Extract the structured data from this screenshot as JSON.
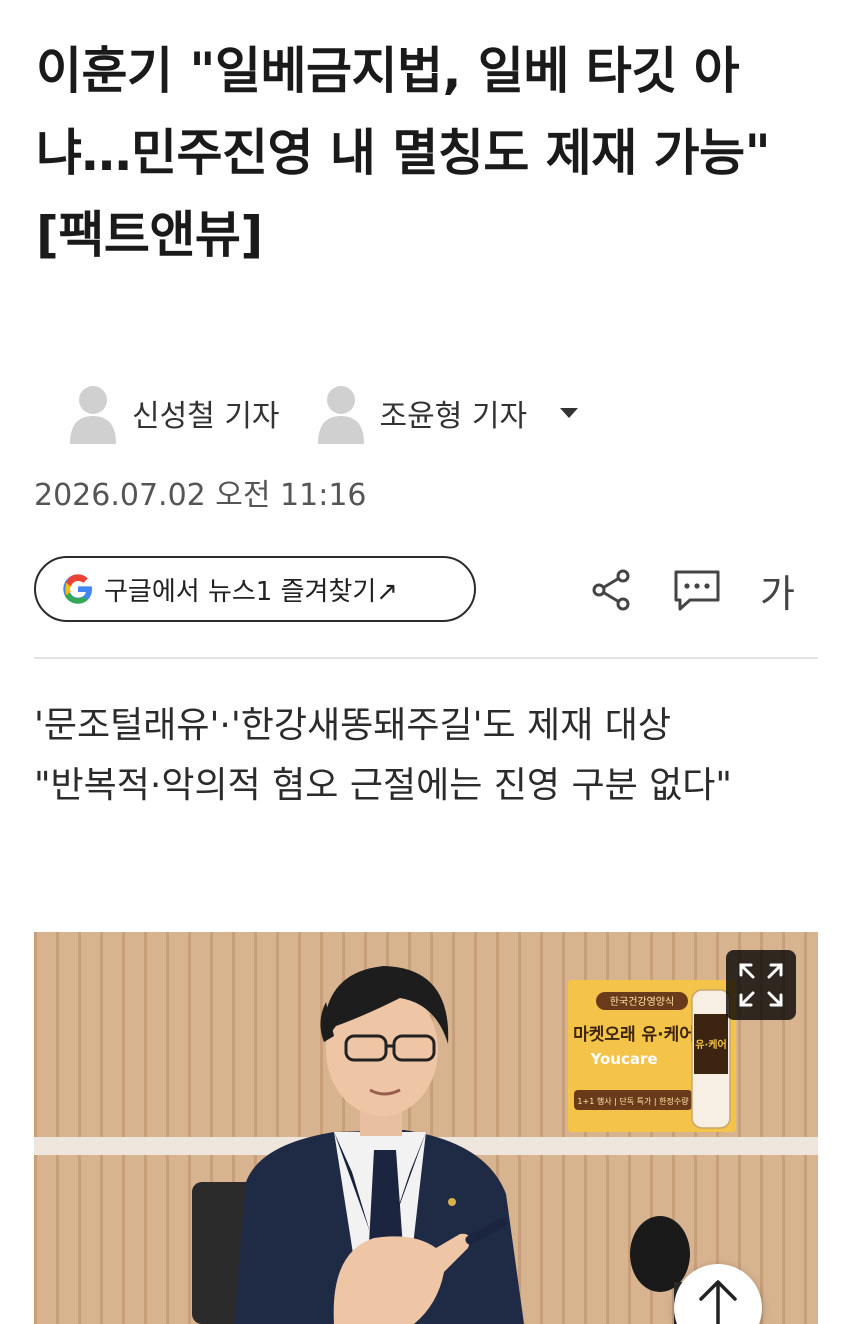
{
  "article": {
    "headline": "이훈기 \"일베금지법, 일베 타깃 아냐…민주진영 내 멸칭도 제재 가능\" [팩트앤뷰]",
    "reporters": [
      {
        "name": "신성철 기자"
      },
      {
        "name": "조윤형 기자"
      }
    ],
    "datetime": "2026.07.02 오전 11:16",
    "subheadings": [
      "'문조털래유'·'한강새똥돼주길'도 제재 대상",
      "\"반복적·악의적 혐오 근절에는 진영 구분 없다\""
    ]
  },
  "google_follow": {
    "label": "구글에서 뉴스1 즐겨찾기↗"
  },
  "toolbar": {
    "font_size_label": "가"
  },
  "photo": {
    "ad_board": {
      "top_badge": "한국건강영양식",
      "line1": "마켓오래 유·케어",
      "line2": "Youcare",
      "footer": "1+1 행사 | 단독 특가 | 한정수량",
      "bottle_label": "유·케어"
    }
  },
  "icons": {
    "avatar": "person-silhouette-icon",
    "dropdown": "caret-down-icon",
    "google": "google-g-icon",
    "share": "share-icon",
    "comment": "comment-icon",
    "expand": "expand-icon",
    "scroll_top": "arrow-up-icon"
  },
  "colors": {
    "headline": "#1a1a1a",
    "divider": "#e3e3e3",
    "wall": "#d7b592"
  }
}
